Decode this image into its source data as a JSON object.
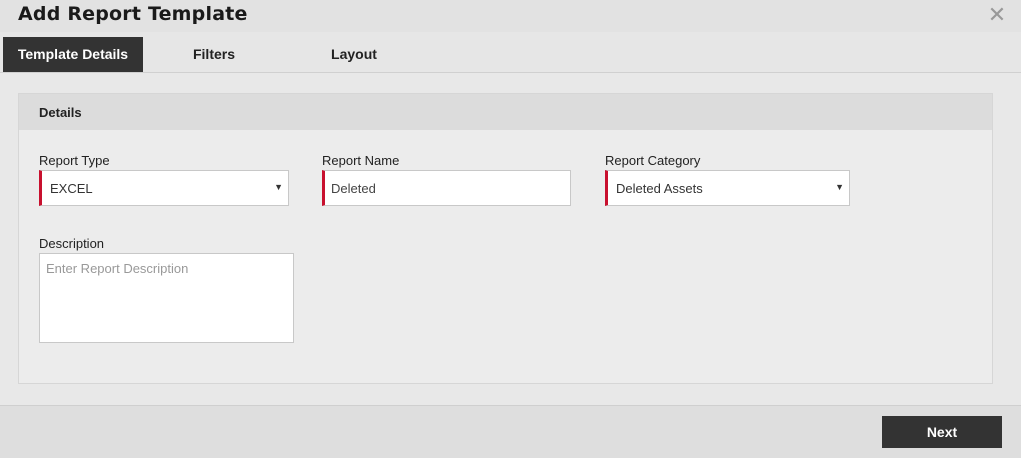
{
  "dialog": {
    "title": "Add Report Template",
    "close_icon": "close-icon"
  },
  "tabs": [
    {
      "label": "Template Details",
      "active": true
    },
    {
      "label": "Filters",
      "active": false
    },
    {
      "label": "Layout",
      "active": false
    }
  ],
  "details": {
    "heading": "Details",
    "report_type": {
      "label": "Report Type",
      "value": "EXCEL"
    },
    "report_name": {
      "label": "Report Name",
      "value": "Deleted"
    },
    "report_category": {
      "label": "Report Category",
      "value": "Deleted Assets"
    },
    "description": {
      "label": "Description",
      "placeholder": "Enter Report Description",
      "value": ""
    }
  },
  "footer": {
    "next_label": "Next"
  },
  "colors": {
    "accent_required": "#c8102e",
    "dark_button": "#333333"
  }
}
